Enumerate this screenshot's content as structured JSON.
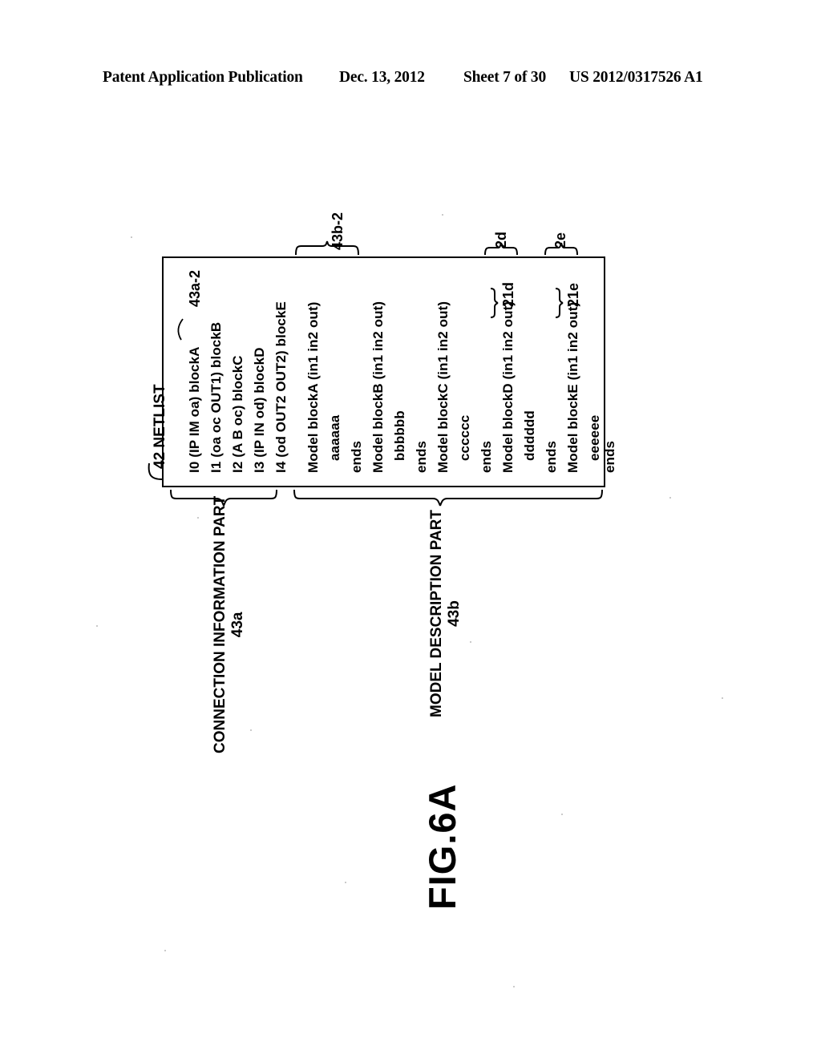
{
  "header": {
    "publication": "Patent Application Publication",
    "date": "Dec. 13, 2012",
    "sheet": "Sheet 7 of 30",
    "number": "US 2012/0317526 A1"
  },
  "figure": {
    "label": "FIG.6A"
  },
  "diagram": {
    "netlist_label": "42 NETLIST",
    "connection_part": {
      "name": "CONNECTION INFORMATION PART",
      "ref": "43a",
      "callout_ref": "43a-2",
      "lines": [
        "I0 (IP IM oa) blockA",
        "I1 (oa oc OUT1) blockB",
        "I2 (A B oc) blockC",
        "I3 (IP IN od) blockD",
        "I4 (od OUT2 OUT2) blockE"
      ]
    },
    "model_part": {
      "name": "MODEL DESCRIPTION PART",
      "ref": "43b",
      "callout_ref": "43b-2",
      "blocks": [
        {
          "header": "Model blockA (in1 in2 out)",
          "body": "aaaaaa",
          "end": "ends",
          "inner_ref": "",
          "outer_ref": ""
        },
        {
          "header": "Model blockB (in1 in2 out)",
          "body": "bbbbbb",
          "end": "ends",
          "inner_ref": "",
          "outer_ref": ""
        },
        {
          "header": "Model blockC (in1 in2 out)",
          "body": "cccccc",
          "end": "ends",
          "inner_ref": "",
          "outer_ref": ""
        },
        {
          "header": "Model blockD (in1 in2 out)",
          "body": "dddddd",
          "end": "ends",
          "inner_ref": "21d",
          "outer_ref": "2d"
        },
        {
          "header": "Model blockE (in1 in2 out)",
          "body": "eeeeee",
          "end": "ends",
          "inner_ref": "21e",
          "outer_ref": "2e"
        }
      ]
    }
  }
}
